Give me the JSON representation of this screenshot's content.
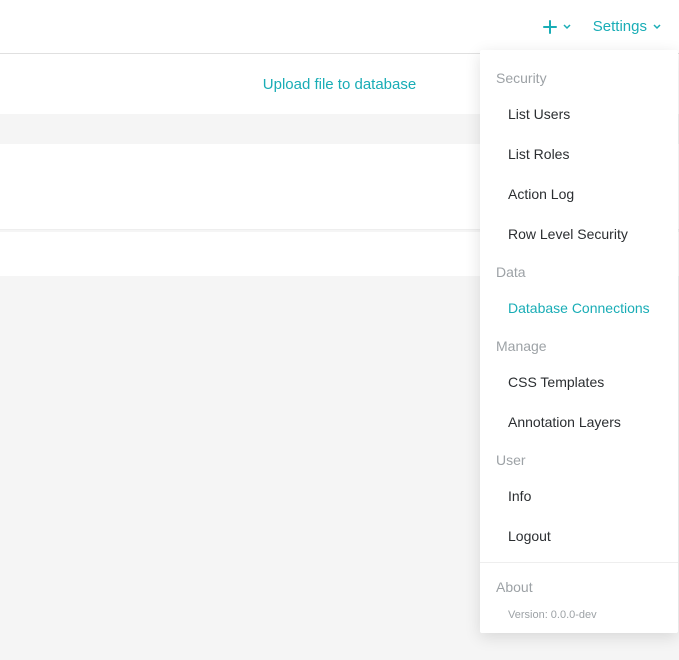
{
  "topbar": {
    "settings_label": "Settings"
  },
  "upload": {
    "label": "Upload file to database"
  },
  "menu": {
    "sections": [
      {
        "header": "Security",
        "items": [
          {
            "label": "List Users",
            "active": false
          },
          {
            "label": "List Roles",
            "active": false
          },
          {
            "label": "Action Log",
            "active": false
          },
          {
            "label": "Row Level Security",
            "active": false
          }
        ]
      },
      {
        "header": "Data",
        "items": [
          {
            "label": "Database Connections",
            "active": true
          }
        ]
      },
      {
        "header": "Manage",
        "items": [
          {
            "label": "CSS Templates",
            "active": false
          },
          {
            "label": "Annotation Layers",
            "active": false
          }
        ]
      },
      {
        "header": "User",
        "items": [
          {
            "label": "Info",
            "active": false
          },
          {
            "label": "Logout",
            "active": false
          }
        ]
      }
    ],
    "about": {
      "header": "About",
      "version_label": "Version: 0.0.0-dev"
    }
  }
}
